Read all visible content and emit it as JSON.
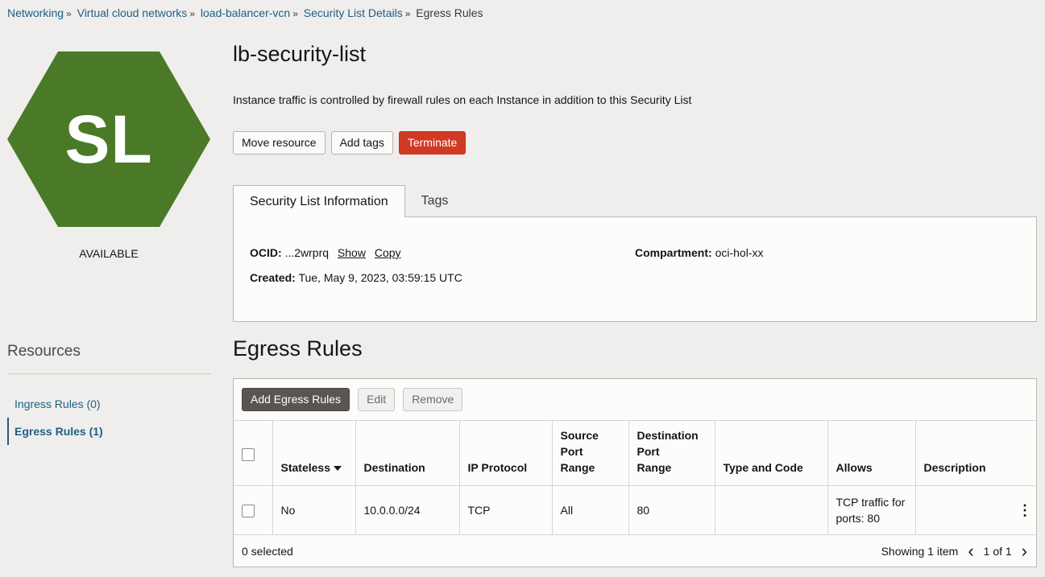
{
  "breadcrumb": {
    "items": [
      "Networking",
      "Virtual cloud networks",
      "load-balancer-vcn",
      "Security List Details"
    ],
    "current": "Egress Rules",
    "separator": "»"
  },
  "resource_icon": {
    "initials": "SL",
    "color": "#4a7a27",
    "status": "AVAILABLE"
  },
  "resources": {
    "heading": "Resources",
    "items": [
      {
        "label": "Ingress Rules (0)",
        "active": false
      },
      {
        "label": "Egress Rules (1)",
        "active": true
      }
    ]
  },
  "header": {
    "title": "lb-security-list",
    "description": "Instance traffic is controlled by firewall rules on each Instance in addition to this Security List",
    "buttons": {
      "move": "Move resource",
      "tags": "Add tags",
      "terminate": "Terminate"
    }
  },
  "tabs": [
    {
      "label": "Security List Information"
    },
    {
      "label": "Tags"
    }
  ],
  "info": {
    "ocid_label": "OCID:",
    "ocid_value": "...2wrprq",
    "show": "Show",
    "copy": "Copy",
    "created_label": "Created:",
    "created_value": "Tue, May 9, 2023, 03:59:15 UTC",
    "compartment_label": "Compartment:",
    "compartment_value": "oci-hol-xx"
  },
  "egress": {
    "title": "Egress Rules",
    "toolbar": {
      "add": "Add Egress Rules",
      "edit": "Edit",
      "remove": "Remove"
    },
    "columns": {
      "stateless": "Stateless",
      "destination": "Destination",
      "protocol": "IP Protocol",
      "source_port_1": "Source",
      "source_port_2": "Port",
      "source_port_3": "Range",
      "dest_port_1": "Destination",
      "dest_port_2": "Port",
      "dest_port_3": "Range",
      "type_code": "Type and Code",
      "allows": "Allows",
      "description": "Description"
    },
    "rows": [
      {
        "stateless": "No",
        "destination": "10.0.0.0/24",
        "protocol": "TCP",
        "source_port": "All",
        "dest_port": "80",
        "type_code": "",
        "allows_1": "TCP traffic for",
        "allows_2": "ports: 80",
        "description": ""
      }
    ],
    "footer": {
      "selected": "0 selected",
      "showing": "Showing 1 item",
      "page": "1 of 1"
    }
  }
}
